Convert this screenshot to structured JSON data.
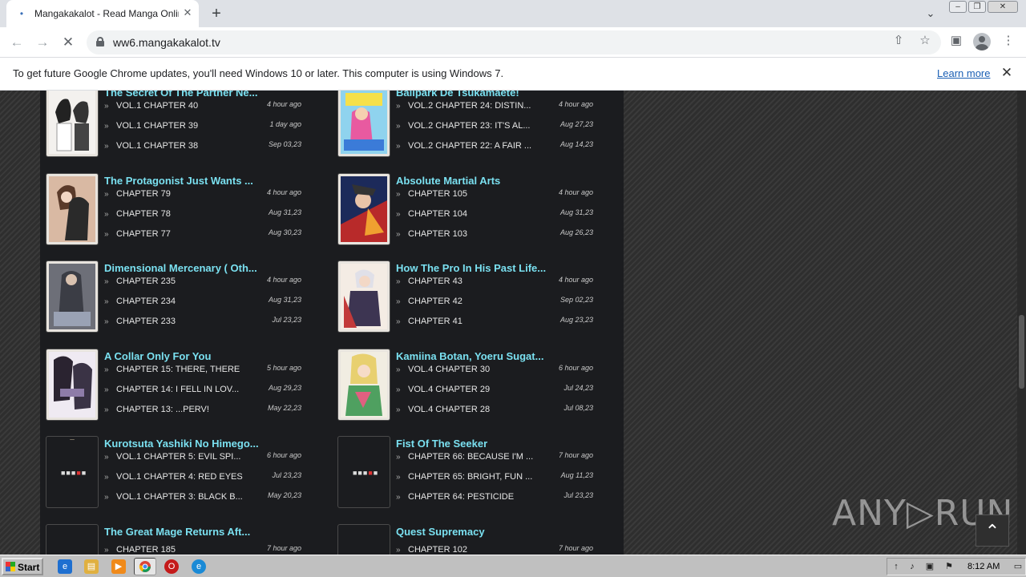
{
  "browser": {
    "tab_title": "Mangakakalot - Read Manga Online Free",
    "favicon": "•",
    "close_tab_glyph": "✕",
    "new_tab_glyph": "+",
    "tab_search_glyph": "⌄",
    "url": "ww6.mangakakalot.tv"
  },
  "infobar": {
    "message": "To get future Google Chrome updates, you'll need Windows 10 or later. This computer is using Windows 7.",
    "learn_more": "Learn more"
  },
  "manga_items": [
    {
      "title": "The Secret Of The Partner Ne...",
      "chapters": [
        {
          "name": "VOL.1 CHAPTER 40",
          "time": "4 hour ago"
        },
        {
          "name": "VOL.1 CHAPTER 39",
          "time": "1 day ago"
        },
        {
          "name": "VOL.1 CHAPTER 38",
          "time": "Sep 03,23"
        }
      ]
    },
    {
      "title": "Ballpark De Tsukamaete!",
      "chapters": [
        {
          "name": "VOL.2 CHAPTER 24: DISTIN...",
          "time": "4 hour ago"
        },
        {
          "name": "VOL.2 CHAPTER 23: IT'S AL...",
          "time": "Aug 27,23"
        },
        {
          "name": "VOL.2 CHAPTER 22: A FAIR ...",
          "time": "Aug 14,23"
        }
      ]
    },
    {
      "title": "The Protagonist Just Wants ...",
      "chapters": [
        {
          "name": "CHAPTER 79",
          "time": "4 hour ago"
        },
        {
          "name": "CHAPTER 78",
          "time": "Aug 31,23"
        },
        {
          "name": "CHAPTER 77",
          "time": "Aug 30,23"
        }
      ]
    },
    {
      "title": "Absolute Martial Arts",
      "chapters": [
        {
          "name": "CHAPTER 105",
          "time": "4 hour ago"
        },
        {
          "name": "CHAPTER 104",
          "time": "Aug 31,23"
        },
        {
          "name": "CHAPTER 103",
          "time": "Aug 26,23"
        }
      ]
    },
    {
      "title": "Dimensional Mercenary ( Oth...",
      "chapters": [
        {
          "name": "CHAPTER 235",
          "time": "4 hour ago"
        },
        {
          "name": "CHAPTER 234",
          "time": "Aug 31,23"
        },
        {
          "name": "CHAPTER 233",
          "time": "Jul 23,23"
        }
      ]
    },
    {
      "title": "How The Pro In His Past Life...",
      "chapters": [
        {
          "name": "CHAPTER 43",
          "time": "4 hour ago"
        },
        {
          "name": "CHAPTER 42",
          "time": "Sep 02,23"
        },
        {
          "name": "CHAPTER 41",
          "time": "Aug 23,23"
        }
      ]
    },
    {
      "title": "A Collar Only For You",
      "chapters": [
        {
          "name": "CHAPTER 15: THERE, THERE",
          "time": "5 hour ago"
        },
        {
          "name": "CHAPTER 14: I FELL IN LOV...",
          "time": "Aug 29,23"
        },
        {
          "name": "CHAPTER 13: ...PERV!",
          "time": "May 22,23"
        }
      ]
    },
    {
      "title": "Kamiina Botan, Yoeru Sugat...",
      "chapters": [
        {
          "name": "VOL.4 CHAPTER 30",
          "time": "6 hour ago"
        },
        {
          "name": "VOL.4 CHAPTER 29",
          "time": "Jul 24,23"
        },
        {
          "name": "VOL.4 CHAPTER 28",
          "time": "Jul 08,23"
        }
      ]
    },
    {
      "title": "Kurotsuta Yashiki No Himego...",
      "chapters": [
        {
          "name": "VOL.1 CHAPTER 5: EVIL SPI...",
          "time": "6 hour ago"
        },
        {
          "name": "VOL.1 CHAPTER 4: RED EYES",
          "time": "Jul 23,23"
        },
        {
          "name": "VOL.1 CHAPTER 3: BLACK B...",
          "time": "May 20,23"
        }
      ]
    },
    {
      "title": "Fist Of The Seeker",
      "chapters": [
        {
          "name": "CHAPTER 66: BECAUSE I'M ...",
          "time": "7 hour ago"
        },
        {
          "name": "CHAPTER 65: BRIGHT, FUN ...",
          "time": "Aug 11,23"
        },
        {
          "name": "CHAPTER 64: PESTICIDE",
          "time": "Jul 23,23"
        }
      ]
    },
    {
      "title": "The Great Mage Returns Aft...",
      "chapters": [
        {
          "name": "CHAPTER 185",
          "time": "7 hour ago"
        }
      ]
    },
    {
      "title": "Quest Supremacy",
      "chapters": [
        {
          "name": "CHAPTER 102",
          "time": "7 hour ago"
        }
      ]
    }
  ],
  "watermark": "ANY▷RUN",
  "taskbar": {
    "start_label": "Start",
    "clock": "8:12 AM"
  }
}
